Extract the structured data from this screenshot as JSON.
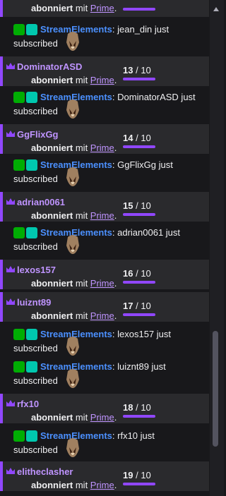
{
  "top": {
    "bold": "abonniert",
    "mid": " mit ",
    "link": "Prime",
    "tail": "."
  },
  "bot_name": "StreamElements",
  "colon": ":",
  "bot_msg_tail": "subscribed",
  "messages": [
    {
      "user": "jean_din",
      "text": " jean_din just"
    },
    {
      "user": "DominatorASD",
      "count": "13",
      "total": "10"
    },
    {
      "user": "DominatorASD",
      "text": " DominatorASD just"
    },
    {
      "user": "GgFlixGg",
      "count": "14",
      "total": "10"
    },
    {
      "user": "GgFlixGg",
      "text": " GgFlixGg just"
    },
    {
      "user": "adrian0061",
      "count": "15",
      "total": "10"
    },
    {
      "user": "adrian0061",
      "text": " adrian0061 just"
    },
    {
      "user": "lexos157",
      "count": "16",
      "total": "10"
    },
    {
      "user": "luiznt89",
      "count": "17",
      "total": "10"
    },
    {
      "user": "lexos157",
      "text": " lexos157 just"
    },
    {
      "user": "luiznt89",
      "text": " luiznt89 just"
    },
    {
      "user": "rfx10",
      "count": "18",
      "total": "10"
    },
    {
      "user": "rfx10",
      "text": " rfx10 just"
    },
    {
      "user": "elitheclasher",
      "count": "19",
      "total": "10"
    }
  ],
  "sub_line": {
    "bold": "abonniert",
    "mid": " mit ",
    "link": "Prime",
    "tail": "."
  },
  "slash": " / ",
  "colors": {
    "accent": "#9147ff",
    "sub_name": "#bf94ff",
    "bot": "#4b90ff",
    "bg": "#18181b",
    "sub_bg": "#2a2a2d"
  },
  "icons": [
    "crown-icon",
    "verified-badge-icon",
    "bot-badge-icon",
    "skull-emote-icon",
    "scroll-up-icon"
  ]
}
